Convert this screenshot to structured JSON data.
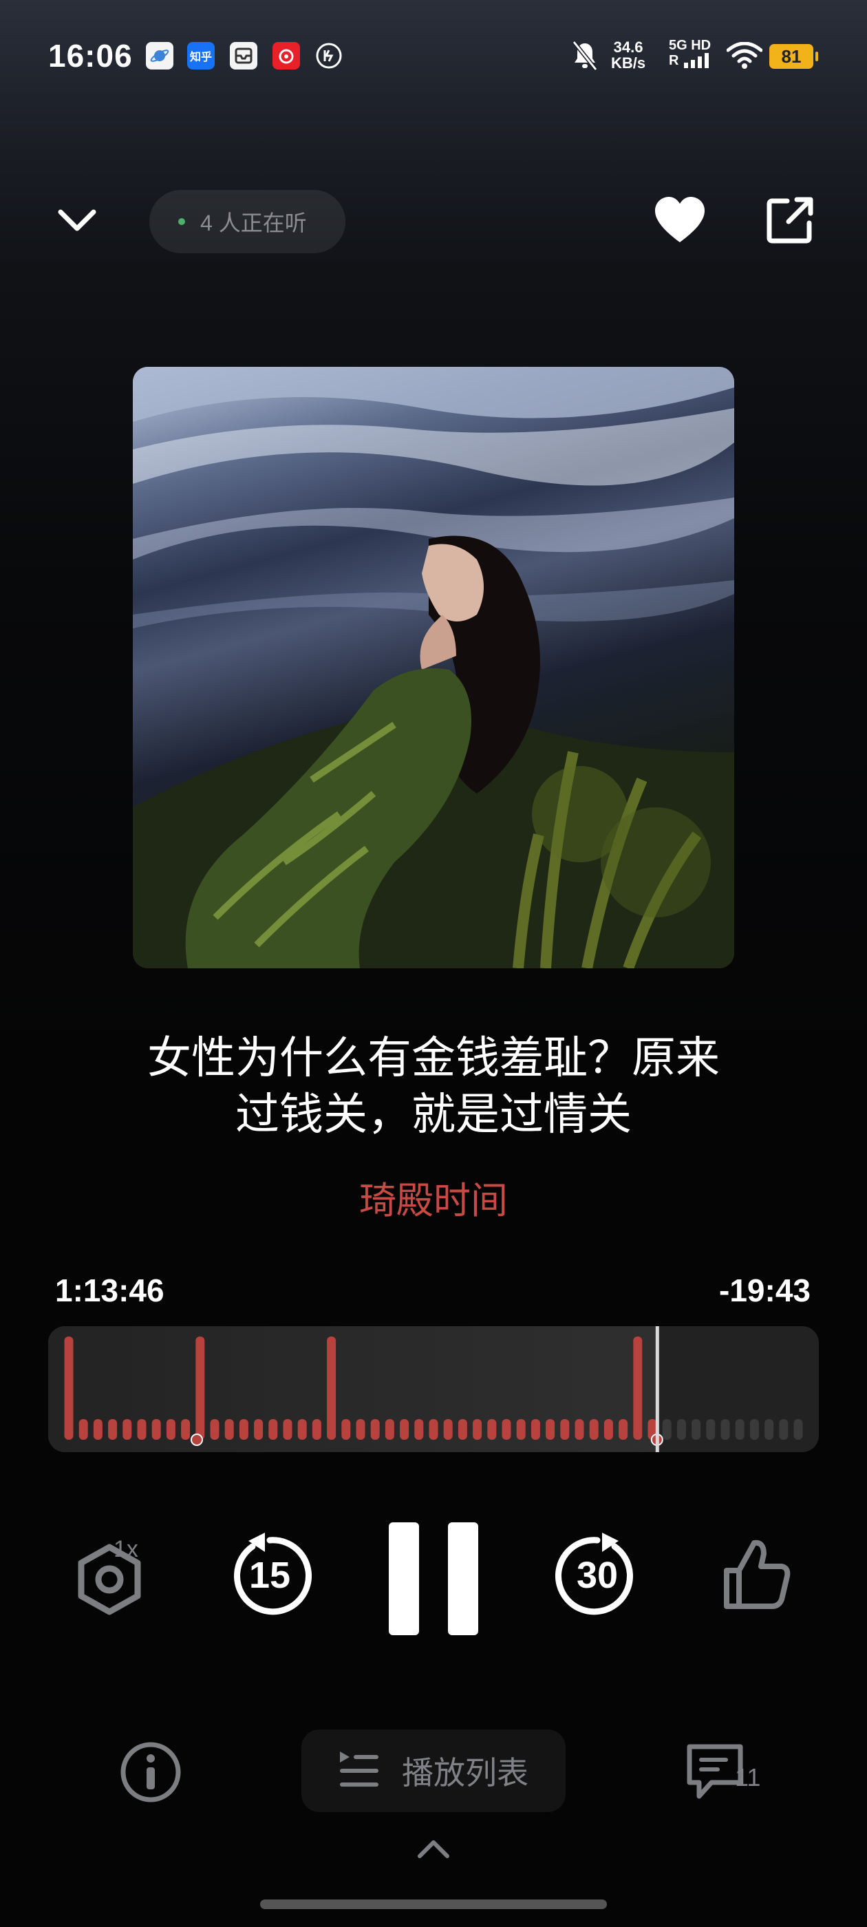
{
  "status_bar": {
    "time": "16:06",
    "apps": [
      {
        "icon": "planet-app-icon",
        "label": "",
        "color": "#f2f2f2"
      },
      {
        "icon": "zhihu-app-icon",
        "label": "知乎",
        "color": "#1772f6"
      },
      {
        "icon": "inbox-app-icon",
        "label": "",
        "color": "#f2f2f2"
      },
      {
        "icon": "netease-music-app-icon",
        "label": "",
        "color": "#e8202a"
      },
      {
        "icon": "ev-app-icon",
        "label": "",
        "color": "#f2f2f2"
      }
    ],
    "net_speed_value": "34.6",
    "net_speed_unit": "KB/s",
    "network_top": "5G HD",
    "network_bottom": "R",
    "battery": "81"
  },
  "header": {
    "listeners_text": "4 人正在听"
  },
  "episode": {
    "title_line1": "女性为什么有金钱羞耻？原来",
    "title_line2": "过钱关，就是过情关",
    "author": "琦殿时间"
  },
  "progress": {
    "elapsed": "1:13:46",
    "remaining": "-19:43",
    "played_fraction": 0.79,
    "chapter_markers": 4
  },
  "controls": {
    "speed_label": "1x",
    "rewind_seconds": "15",
    "forward_seconds": "30",
    "state": "playing"
  },
  "bottom_bar": {
    "playlist_label": "播放列表",
    "comment_count": "11"
  },
  "colors": {
    "accent": "#c94a45",
    "wave_played": "#b8423d",
    "wave_unplayed": "#3a3a3a",
    "muted_text": "#808287"
  }
}
